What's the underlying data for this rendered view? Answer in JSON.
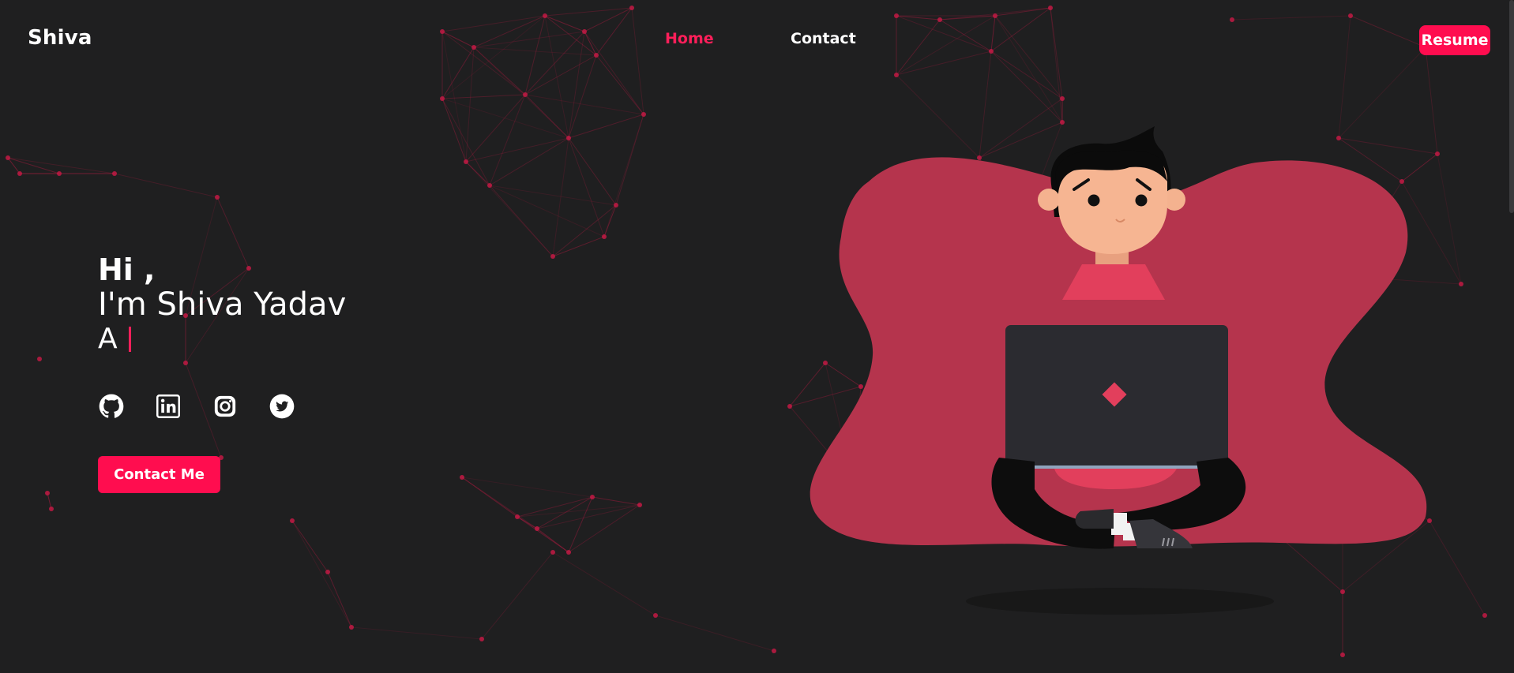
{
  "navbar": {
    "brand": "Shiva",
    "links": [
      {
        "label": "Home",
        "active": true
      },
      {
        "label": "Contact",
        "active": false
      }
    ],
    "resume_label": "Resume"
  },
  "hero": {
    "greeting": "Hi ,",
    "name_line": "I'm Shiva Yadav",
    "typed_text": "A"
  },
  "socials": [
    {
      "name": "github",
      "icon": "github-icon"
    },
    {
      "name": "linkedin",
      "icon": "linkedin-icon"
    },
    {
      "name": "instagram",
      "icon": "instagram-icon"
    },
    {
      "name": "twitter",
      "icon": "twitter-icon"
    }
  ],
  "cta": {
    "contact_label": "Contact Me"
  },
  "colors": {
    "background": "#1f1f20",
    "accent": "#ff0d4f",
    "blob": "#b5344d",
    "network": "#c21a44"
  }
}
